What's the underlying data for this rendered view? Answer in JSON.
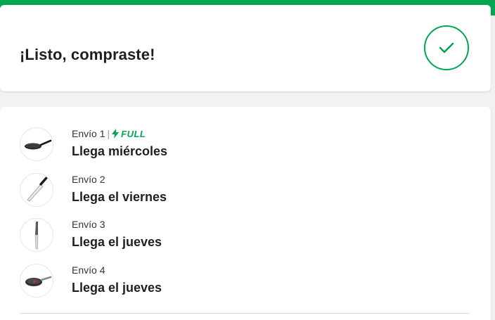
{
  "success": {
    "title": "¡Listo, compraste!",
    "icon": "check-icon"
  },
  "shipments": [
    {
      "label": "Envío 1",
      "badge": "FULL",
      "title": "Llega miércoles",
      "image": "frying-pan"
    },
    {
      "label": "Envío 2",
      "badge": "",
      "title": "Llega el viernes",
      "image": "chef-knife"
    },
    {
      "label": "Envío 3",
      "badge": "",
      "title": "Llega el jueves",
      "image": "kitchen-knife"
    },
    {
      "label": "Envío 4",
      "badge": "",
      "title": "Llega el jueves",
      "image": "frying-pan"
    }
  ],
  "colors": {
    "accent": "#00a650",
    "background": "#f2f2f2",
    "card": "#ffffff",
    "text": "#1f1f1f"
  }
}
